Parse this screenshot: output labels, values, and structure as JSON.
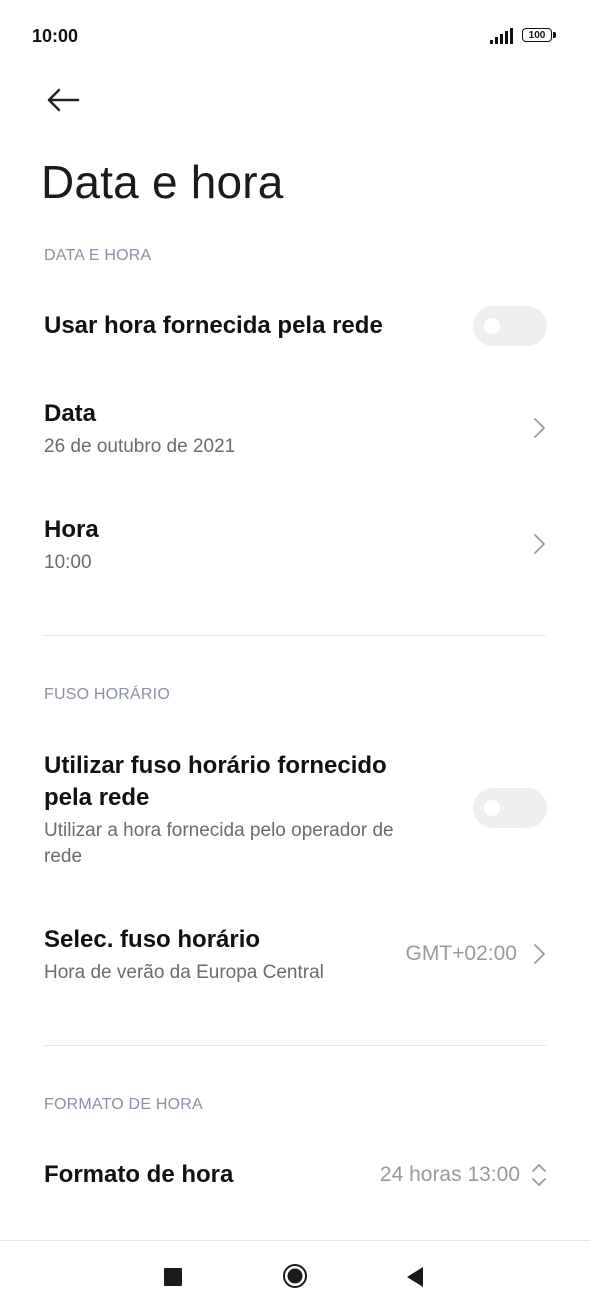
{
  "status_bar": {
    "time": "10:00",
    "battery": "100"
  },
  "header": {
    "title": "Data e hora"
  },
  "section_date_time": {
    "header": "DATA E HORA",
    "use_network_time": {
      "label": "Usar hora fornecida pela rede",
      "enabled": false
    },
    "date": {
      "label": "Data",
      "value": "26 de outubro de 2021"
    },
    "time": {
      "label": "Hora",
      "value": "10:00"
    }
  },
  "section_timezone": {
    "header": "FUSO HORÁRIO",
    "use_network_timezone": {
      "label_line1": "Utilizar fuso horário fornecido",
      "label_line2": "pela rede",
      "desc_line1": "Utilizar a hora fornecida pelo operador de",
      "desc_line2": "rede",
      "enabled": false
    },
    "select_timezone": {
      "label": "Selec. fuso horário",
      "sub": "Hora de verão da Europa Central",
      "value": "GMT+02:00"
    }
  },
  "section_format": {
    "header": "FORMATO DE HORA",
    "time_format": {
      "label": "Formato de hora",
      "value": "24 horas 13:00"
    }
  },
  "icons": {
    "back": "arrow-left-icon",
    "chevron": "chevron-right-icon",
    "updown": "chevron-up-down-icon",
    "nav_recents": "square-icon",
    "nav_home": "circle-icon",
    "nav_back": "triangle-left-icon"
  },
  "colors": {
    "section_header": "#8a91a4",
    "toggle_off": "#eeeeee",
    "secondary_text": "#6b6b6b"
  }
}
